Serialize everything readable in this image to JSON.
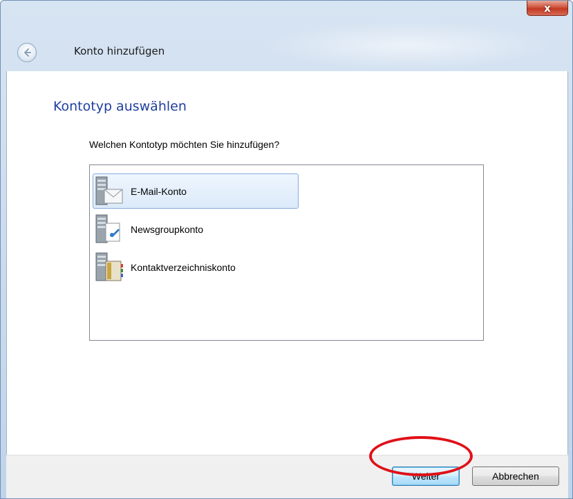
{
  "window": {
    "title": "Konto hinzufügen",
    "close_glyph": "x"
  },
  "content": {
    "heading": "Kontotyp auswählen",
    "question": "Welchen Kontotyp möchten Sie hinzufügen?",
    "items": [
      {
        "label": "E-Mail-Konto",
        "icon": "email-server-icon",
        "selected": true
      },
      {
        "label": "Newsgroupkonto",
        "icon": "newsgroup-server-icon",
        "selected": false
      },
      {
        "label": "Kontaktverzeichniskonto",
        "icon": "directory-server-icon",
        "selected": false
      }
    ]
  },
  "footer": {
    "next_label": "Weiter",
    "cancel_label": "Abbrechen"
  },
  "colors": {
    "heading": "#1f3f9e",
    "highlight": "#e01018",
    "selection_border": "#84acdd"
  }
}
